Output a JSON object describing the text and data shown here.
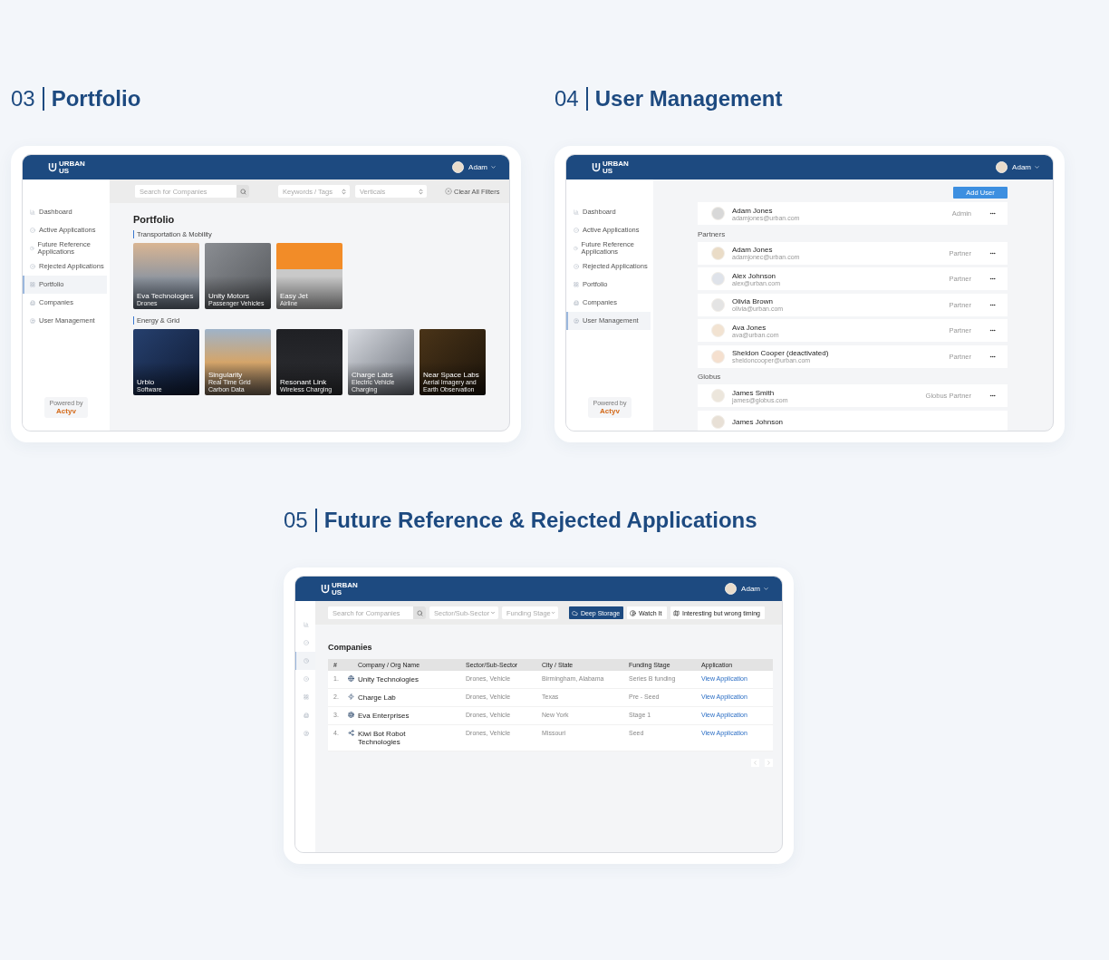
{
  "portfolio": {
    "heading": {
      "number": "03",
      "title": "Portfolio"
    },
    "header": {
      "logo_top": "URBAN",
      "logo_bottom": "US",
      "user": "Adam"
    },
    "sidebar": {
      "items": [
        {
          "kind": "dashboard",
          "label": "Dashboard",
          "selected": false
        },
        {
          "kind": "active",
          "label": "Active Applications",
          "selected": false
        },
        {
          "kind": "future",
          "label": "Future Reference Applications",
          "selected": false
        },
        {
          "kind": "rejected",
          "label": "Rejected Applications",
          "selected": false
        },
        {
          "kind": "portfolio",
          "label": "Portfolio",
          "selected": true
        },
        {
          "kind": "companies",
          "label": "Companies",
          "selected": false
        },
        {
          "kind": "users",
          "label": "User Management",
          "selected": false
        }
      ],
      "powered_by": "Powered by",
      "powered_brand": "Actyv"
    },
    "toolbar": {
      "search_placeholder": "Search for Companies",
      "selects": [
        "Keywords / Tags",
        "Verticals"
      ],
      "clear": "Clear All Filters"
    },
    "title": "Portfolio",
    "groups": [
      {
        "name": "Transportation & Mobility",
        "cards": [
          {
            "name": "Eva Technologies",
            "sub": "Drones"
          },
          {
            "name": "Unity Motors",
            "sub": "Passenger Vehicles"
          },
          {
            "name": "Easy Jet",
            "sub": "Airline"
          }
        ]
      },
      {
        "name": "Energy & Grid",
        "cards": [
          {
            "name": "Urbio",
            "sub": "Software"
          },
          {
            "name": "Singularity",
            "sub": "Real Time Grid Carbon Data"
          },
          {
            "name": "Resonant Link",
            "sub": "Wireless Charging"
          },
          {
            "name": "Charge Labs",
            "sub": "Electric Vehicle Charging"
          },
          {
            "name": "Near Space Labs",
            "sub": "Aerial Imagery and Earth Observation"
          }
        ]
      }
    ]
  },
  "user_management": {
    "heading": {
      "number": "04",
      "title": "User Management"
    },
    "header": {
      "logo_top": "URBAN",
      "logo_bottom": "US",
      "user": "Adam"
    },
    "sidebar": {
      "items": [
        {
          "kind": "dashboard",
          "label": "Dashboard",
          "selected": false
        },
        {
          "kind": "active",
          "label": "Active Applications",
          "selected": false
        },
        {
          "kind": "future",
          "label": "Future Reference Applications",
          "selected": false
        },
        {
          "kind": "rejected",
          "label": "Rejected Applications",
          "selected": false
        },
        {
          "kind": "portfolio",
          "label": "Portfolio",
          "selected": false
        },
        {
          "kind": "companies",
          "label": "Companies",
          "selected": false
        },
        {
          "kind": "users",
          "label": "User Management",
          "selected": true
        }
      ],
      "powered_by": "Powered by",
      "powered_brand": "Actyv"
    },
    "add_button": "Add User",
    "admin": {
      "name": "Adam Jones",
      "email": "adamjones@urban.com",
      "role": "Admin"
    },
    "groups": [
      {
        "name": "Partners",
        "users": [
          {
            "name": "Adam Jones",
            "email": "adamjonec@urban.com",
            "role": "Partner"
          },
          {
            "name": "Alex Johnson",
            "email": "alex@urban.com",
            "role": "Partner"
          },
          {
            "name": "Olivia Brown",
            "email": "olivia@urban.com",
            "role": "Partner"
          },
          {
            "name": "Ava Jones",
            "email": "ava@urban.com",
            "role": "Partner"
          },
          {
            "name": "Sheldon Cooper (deactivated)",
            "email": "sheldoncooper@urban.com",
            "role": "Partner"
          }
        ]
      },
      {
        "name": "Globus",
        "users": [
          {
            "name": "James Smith",
            "email": "james@globus.com",
            "role": "Globus Partner"
          },
          {
            "name": "James Johnson"
          }
        ]
      }
    ]
  },
  "applications": {
    "heading": {
      "number": "05",
      "title": "Future Reference & Rejected Applications"
    },
    "header": {
      "logo_top": "URBAN",
      "logo_bottom": "US",
      "user": "Adam"
    },
    "sidebar": {
      "items": [
        {
          "kind": "dashboard",
          "selected": false
        },
        {
          "kind": "active",
          "selected": false
        },
        {
          "kind": "future",
          "selected": true
        },
        {
          "kind": "rejected",
          "selected": false
        },
        {
          "kind": "portfolio",
          "selected": false
        },
        {
          "kind": "companies",
          "selected": false
        },
        {
          "kind": "users",
          "selected": false
        }
      ]
    },
    "toolbar": {
      "search_placeholder": "Search for Companies",
      "selects": [
        "Sector/Sub-Sector",
        "Funding Stage"
      ],
      "toggles": [
        {
          "kind": "cloud",
          "label": "Deep Storage",
          "selected": true
        },
        {
          "kind": "contrast",
          "label": "Watch It",
          "selected": false
        },
        {
          "kind": "map",
          "label": "Interesting but wrong timing",
          "selected": false
        }
      ]
    },
    "title": "Companies",
    "table": {
      "columns": [
        "#",
        "Company / Org Name",
        "Sector/Sub-Sector",
        "City / State",
        "Funding Stage",
        "Application"
      ],
      "rows": [
        {
          "index": "1.",
          "name": "Unity Technologies",
          "sector": "Drones, Vehicle",
          "city": "Birmingham, Alabama",
          "stage": "Series B funding",
          "link": "View Application"
        },
        {
          "index": "2.",
          "name": "Charge Lab",
          "sector": "Drones, Vehicle",
          "city": "Texas",
          "stage": "Pre - Seed",
          "link": "View Application"
        },
        {
          "index": "3.",
          "name": "Eva Enterprises",
          "sector": "Drones, Vehicle",
          "city": "New York",
          "stage": "Stage 1",
          "link": "View Application"
        },
        {
          "index": "4.",
          "name": "Kiwi Bot Robot Technologies",
          "sector": "Drones, Vehicle",
          "city": "Missouri",
          "stage": "Seed",
          "link": "View Application"
        }
      ]
    }
  }
}
